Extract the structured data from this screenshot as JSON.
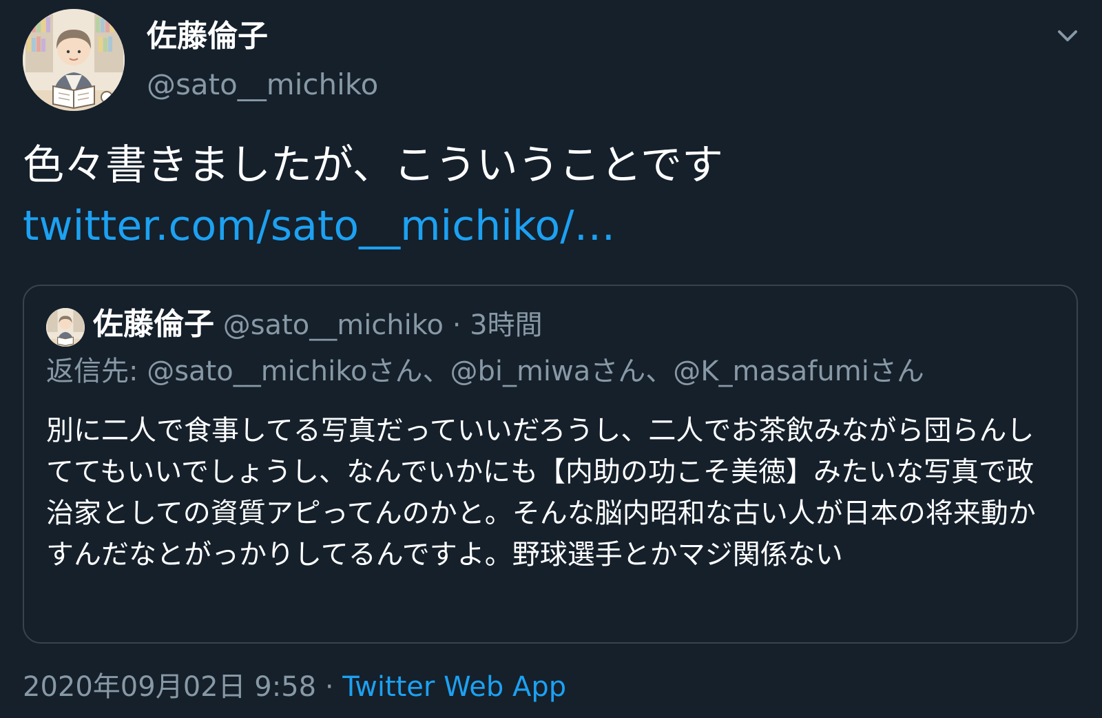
{
  "tweet": {
    "author": {
      "name": "佐藤倫子",
      "handle": "@sato__michiko"
    },
    "text": "色々書きましたが、こういうことです",
    "link": "twitter.com/sato__michiko/…",
    "quote": {
      "author_name": "佐藤倫子",
      "author_handle": "@sato__michiko",
      "separator": "·",
      "time": "3時間",
      "reply_to": "返信先: @sato__michikoさん、@bi_miwaさん、@K_masafumiさん",
      "body": "別に二人で食事してる写真だっていいだろうし、二人でお茶飲みながら団らんしててもいいでしょうし、なんでいかにも【内助の功こそ美徳】みたいな写真で政治家としての資質アピってんのかと。そんな脳内昭和な古い人が日本の将来動かすんだなとがっかりしてるんですよ。野球選手とかマジ関係ない"
    },
    "footer": {
      "datetime": "2020年09月02日 9:58",
      "separator": "·",
      "source": "Twitter Web App"
    }
  },
  "icons": {
    "menu": "chevron-down-icon",
    "avatar": "avatar-illustration"
  },
  "colors": {
    "background": "#15202b",
    "text_primary": "#ffffff",
    "text_secondary": "#8899a6",
    "link": "#1da1f2",
    "border": "#38444d"
  }
}
